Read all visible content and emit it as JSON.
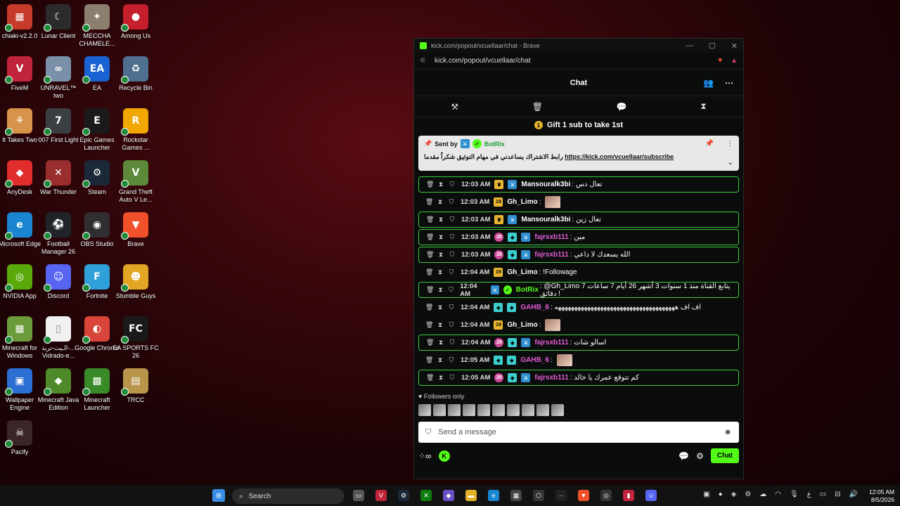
{
  "desktop_icons": [
    {
      "label": "chiaki-v2.2.0",
      "color": "#c63a2a",
      "glyph": "▦"
    },
    {
      "label": "Lunar Client",
      "color": "#2b2b2b",
      "glyph": "☾"
    },
    {
      "label": "MECCHA CHAMELE...",
      "color": "#8c7f6f",
      "glyph": "✦"
    },
    {
      "label": "Among Us",
      "color": "#c51f2b",
      "glyph": "●"
    },
    {
      "label": "FiveM",
      "color": "#c0243a",
      "glyph": "Ⅴ"
    },
    {
      "label": "UNRAVEL™ two",
      "color": "#7a90a8",
      "glyph": "∞"
    },
    {
      "label": "EA",
      "color": "#1862d1",
      "glyph": "EA"
    },
    {
      "label": "Recycle Bin",
      "color": "#4f6f8f",
      "glyph": "♻"
    },
    {
      "label": "It Takes Two",
      "color": "#d8934a",
      "glyph": "⚘"
    },
    {
      "label": "007 First Light",
      "color": "#3a3f44",
      "glyph": "7"
    },
    {
      "label": "Epic Games Launcher",
      "color": "#1a1a1a",
      "glyph": "E"
    },
    {
      "label": "Rockstar Games ...",
      "color": "#f0a800",
      "glyph": "R"
    },
    {
      "label": "AnyDesk",
      "color": "#e22d2d",
      "glyph": "◆"
    },
    {
      "label": "War Thunder",
      "color": "#9a2e2e",
      "glyph": "✕"
    },
    {
      "label": "Steam",
      "color": "#1b2838",
      "glyph": "⚙"
    },
    {
      "label": "Grand Theft Auto V Le...",
      "color": "#5c8a3a",
      "glyph": "V"
    },
    {
      "label": "Microsoft Edge",
      "color": "#1a86d1",
      "glyph": "e"
    },
    {
      "label": "Football Manager 26",
      "color": "#20242a",
      "glyph": "⚽"
    },
    {
      "label": "OBS Studio",
      "color": "#302e31",
      "glyph": "◉"
    },
    {
      "label": "Brave",
      "color": "#f0502a",
      "glyph": "▼"
    },
    {
      "label": "NVIDIA App",
      "color": "#5aa90a",
      "glyph": "◎"
    },
    {
      "label": "Discord",
      "color": "#5865f2",
      "glyph": "☺"
    },
    {
      "label": "Fortnite",
      "color": "#2fa0d9",
      "glyph": "F"
    },
    {
      "label": "Stumble Guys",
      "color": "#e3a624",
      "glyph": "☻"
    },
    {
      "label": "Minecraft for Windows",
      "color": "#6b9b3a",
      "glyph": "▦"
    },
    {
      "label": "الـيت-تريد-... Vidrado-e...",
      "color": "#f0f0f0",
      "glyph": "▯"
    },
    {
      "label": "Google Chrome",
      "color": "#d9453a",
      "glyph": "◐"
    },
    {
      "label": "EA SPORTS FC 26",
      "color": "#1a1a1a",
      "glyph": "FC"
    },
    {
      "label": "Wallpaper Engine",
      "color": "#2a6fd1",
      "glyph": "▣"
    },
    {
      "label": "Minecraft Java Edition",
      "color": "#4f8a2a",
      "glyph": "◆"
    },
    {
      "label": "Minecraft Launcher",
      "color": "#3a8a2a",
      "glyph": "▩"
    },
    {
      "label": "TRCC",
      "color": "#b8954a",
      "glyph": "▤"
    },
    {
      "label": "Pacify",
      "color": "#3a2626",
      "glyph": "☠"
    }
  ],
  "browser": {
    "title": "kick.com/popout/vcuellaar/chat - Brave",
    "url": "kick.com/popout/vcuellaar/chat",
    "controls": [
      "—",
      "☐",
      "✕"
    ]
  },
  "chat": {
    "header": "Chat",
    "gift_text": "Gift 1 sub to take 1st",
    "pinned": {
      "sent_by_label": "Sent by",
      "sender": "BotRix",
      "text": "رابط الاشتراك يساعدني في مهام التوثيق شكراً مقدما",
      "link": "https://kick.com/vcuellaar/subscribe"
    },
    "messages": [
      {
        "time": "12:03 AM",
        "badges": [
          "crown",
          "mod"
        ],
        "user": "Mansouralk3bi",
        "color": "#ffffff",
        "text": ": تعال دس",
        "hl": true
      },
      {
        "time": "12:03 AM",
        "badges": [
          "sub"
        ],
        "user": "Gh_Limo",
        "color": "#ffffff",
        "text": ":",
        "emote": true,
        "hl": false
      },
      {
        "time": "12:03 AM",
        "badges": [
          "crown",
          "mod"
        ],
        "user": "Mansouralk3bi",
        "color": "#ffffff",
        "text": ": تعال زين",
        "hl": true
      },
      {
        "time": "12:03 AM",
        "badges": [
          "pink",
          "og",
          "mod"
        ],
        "user": "fajrsxb111",
        "color": "#e25bd6",
        "text": ": مين",
        "hl": true
      },
      {
        "time": "12:03 AM",
        "badges": [
          "pink",
          "og",
          "mod"
        ],
        "user": "fajrsxb111",
        "color": "#e25bd6",
        "text": ": الله يسعدك لا داعي",
        "hl": true
      },
      {
        "time": "12:04 AM",
        "badges": [
          "sub"
        ],
        "user": "Gh_Limo",
        "color": "#ffffff",
        "text": ": !Followage",
        "hl": false
      },
      {
        "time": "12:04 AM",
        "badges": [
          "mod",
          "vip"
        ],
        "user": "BotRix",
        "color": "#53fc18",
        "text": ": @Gh_Limo يتابع القناة منذ 1 سنوات 3 أشهر 26 أيام 7 ساعات 7 دقائق !",
        "hl": true
      },
      {
        "time": "12:04 AM",
        "badges": [
          "og",
          "og"
        ],
        "user": "GAHB_6",
        "color": "#e25bd6",
        "text": ": اف اف هههههههههههههههههههههههههههههههههههههه",
        "hl": false
      },
      {
        "time": "12:04 AM",
        "badges": [
          "sub"
        ],
        "user": "Gh_Limo",
        "color": "#ffffff",
        "text": ":",
        "emote": true,
        "hl": false
      },
      {
        "time": "12:04 AM",
        "badges": [
          "pink",
          "og",
          "mod"
        ],
        "user": "fajrsxb111",
        "color": "#e25bd6",
        "text": ": اسالو شات",
        "hl": true
      },
      {
        "time": "12:05 AM",
        "badges": [
          "og",
          "og"
        ],
        "user": "GAHB_6",
        "color": "#e25bd6",
        "text": ":",
        "emote": true,
        "hl": false
      },
      {
        "time": "12:05 AM",
        "badges": [
          "pink",
          "og",
          "mod"
        ],
        "user": "fajrsxb111",
        "color": "#e25bd6",
        "text": ": كم تتوقع عمرك يا خالد",
        "hl": true
      }
    ],
    "followers_only": "Followers only",
    "input_placeholder": "Send a message",
    "chat_button": "Chat"
  },
  "taskbar": {
    "search_label": "Search",
    "clock_time": "12:05 AM",
    "clock_date": "8/5/2026",
    "lang": "ع"
  }
}
